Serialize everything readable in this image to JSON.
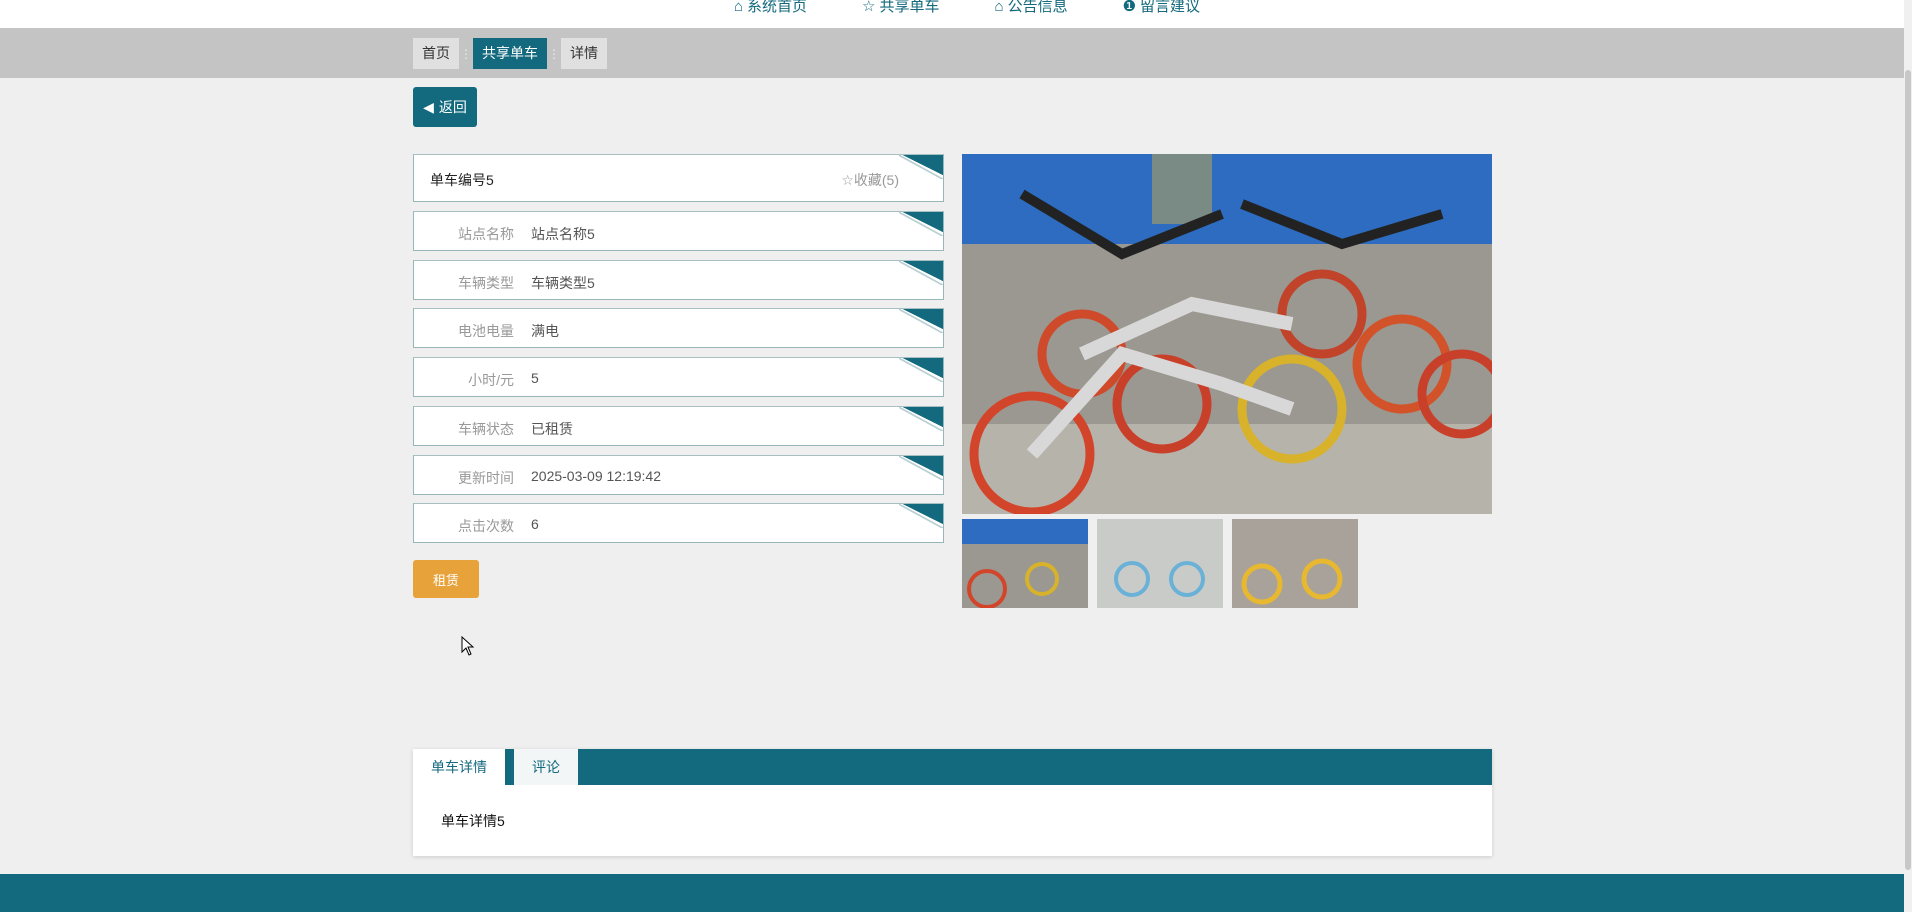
{
  "nav": [
    {
      "icon": "home-icon",
      "glyph": "⌂",
      "label": "系统首页"
    },
    {
      "icon": "star-icon",
      "glyph": "☆",
      "label": "共享单车"
    },
    {
      "icon": "bag-icon",
      "glyph": "⌂",
      "label": "公告信息"
    },
    {
      "icon": "info-icon",
      "glyph": "❶",
      "label": "留言建议"
    }
  ],
  "breadcrumb": [
    "首页",
    "共享单车",
    "详情"
  ],
  "back_label": "返回",
  "title": "单车编号5",
  "favorite": "☆收藏(5)",
  "fields": [
    {
      "label": "站点名称",
      "value": "站点名称5"
    },
    {
      "label": "车辆类型",
      "value": "车辆类型5"
    },
    {
      "label": "电池电量",
      "value": "满电"
    },
    {
      "label": "小时/元",
      "value": "5"
    },
    {
      "label": "车辆状态",
      "value": "已租赁"
    },
    {
      "label": "更新时间",
      "value": "2025-03-09 12:19:42"
    },
    {
      "label": "点击次数",
      "value": "6"
    }
  ],
  "rent_label": "租赁",
  "tabs": [
    "单车详情",
    "评论"
  ],
  "tab_content": "单车详情5",
  "colors": {
    "primary": "#13697e",
    "accent": "#e8a23a"
  }
}
